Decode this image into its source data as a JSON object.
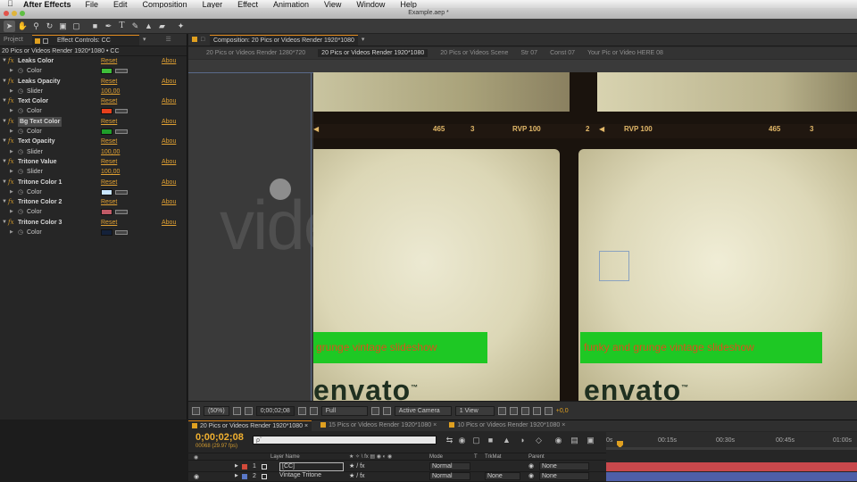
{
  "menubar": {
    "app_name": "After Effects",
    "items": [
      "File",
      "Edit",
      "Composition",
      "Layer",
      "Effect",
      "Animation",
      "View",
      "Window",
      "Help"
    ]
  },
  "window": {
    "title": "Example.aep *"
  },
  "left_panel": {
    "tabs": [
      "Project",
      "Effect Controls: CC"
    ],
    "subtitle": "20 Pics or Videos Render 1920*1080 • CC",
    "reset_label": "Reset",
    "about_label": "Abou",
    "effects": [
      {
        "name": "Leaks Color",
        "props": [
          {
            "name": "Color",
            "type": "color",
            "color": "#3fbf3a"
          }
        ]
      },
      {
        "name": "Leaks Opacity",
        "props": [
          {
            "name": "Slider",
            "type": "value",
            "value": "100,00"
          }
        ]
      },
      {
        "name": "Text Color",
        "props": [
          {
            "name": "Color",
            "type": "color",
            "color": "#e8401c"
          }
        ]
      },
      {
        "name": "Bg Text Color",
        "selected": true,
        "props": [
          {
            "name": "Color",
            "type": "color",
            "color": "#1f9e2a"
          }
        ]
      },
      {
        "name": "Text Opacity",
        "props": [
          {
            "name": "Slider",
            "type": "value",
            "value": "100,00"
          }
        ]
      },
      {
        "name": "Tritone Value",
        "props": [
          {
            "name": "Slider",
            "type": "value",
            "value": "100,00"
          }
        ]
      },
      {
        "name": "Tritone Color 1",
        "props": [
          {
            "name": "Color",
            "type": "color",
            "color": "#c9e6ff"
          }
        ]
      },
      {
        "name": "Tritone Color 2",
        "props": [
          {
            "name": "Color",
            "type": "color",
            "color": "#c05a66"
          }
        ]
      },
      {
        "name": "Tritone Color 3",
        "props": [
          {
            "name": "Color",
            "type": "color",
            "color": "#14213a"
          }
        ]
      }
    ]
  },
  "comp_panel": {
    "tab": "Composition: 20 Pics or Videos Render 1920*1080",
    "breadcrumbs": [
      "20 Pics or Videos Render 1280*720",
      "20 Pics or Videos Render 1920*1080",
      "20 Pics or Videos Scene",
      "Str 07",
      "Const 07",
      "Your Pic or Video HERE 08"
    ],
    "active_breadcrumb": 1,
    "film": {
      "label_left_1": "465",
      "label_left_2": "3",
      "label_left_3": "RVP 100",
      "label_mid_1": "2",
      "label_mid_2": "RVP 100",
      "label_right_1": "465",
      "label_right_2": "3",
      "caption_left": "grunge vintage slideshow",
      "caption_right": "funky and grunge vintage slideshow",
      "logo_text": "envato",
      "watermark": "videohive"
    },
    "footer": {
      "zoom": "(50%)",
      "timecode": "0;00;02;08",
      "resolution": "Full",
      "camera": "Active Camera",
      "views": "1 View",
      "exposure": "+0,0"
    }
  },
  "timeline": {
    "tabs": [
      {
        "label": "20 Pics or Videos Render 1920*1080",
        "color": "#e0a020"
      },
      {
        "label": "15 Pics or Videos Render 1920*1080",
        "color": "#e0a020"
      },
      {
        "label": "10 Pics or Videos Render 1920*1080",
        "color": "#e0a020"
      }
    ],
    "timecode": "0;00;02;08",
    "fps": "00068 (29.97 fps)",
    "search_placeholder": "ρˇ",
    "ruler_ticks": [
      "0s",
      "00:15s",
      "00:30s",
      "00:45s",
      "01:00s"
    ],
    "columns": {
      "layer_name": "Layer Name",
      "mode": "Mode",
      "t": "T",
      "trkmat": "TrkMat",
      "parent": "Parent"
    },
    "layers": [
      {
        "num": "1",
        "name": "[CC]",
        "label_color": "#d24a3a",
        "mode": "Normal",
        "trkmat": "",
        "parent": "None",
        "bar_color": "#c8484c"
      },
      {
        "num": "2",
        "name": "Vintage Tritone",
        "label_color": "#5a78c8",
        "mode": "Normal",
        "trkmat": "None",
        "parent": "None",
        "bar_color": "#4e5fa8"
      }
    ]
  }
}
